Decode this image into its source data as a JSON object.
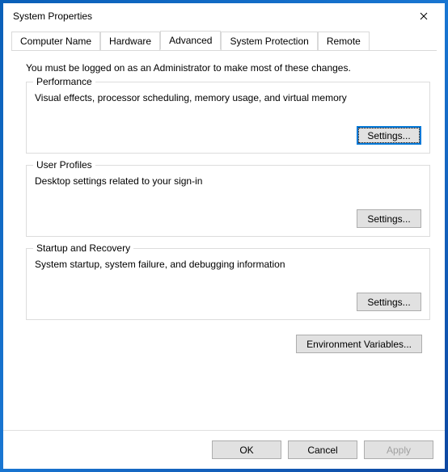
{
  "titlebar": {
    "title": "System Properties"
  },
  "tabs": {
    "computer_name": "Computer Name",
    "hardware": "Hardware",
    "advanced": "Advanced",
    "system_protection": "System Protection",
    "remote": "Remote"
  },
  "panel": {
    "intro": "You must be logged on as an Administrator to make most of these changes."
  },
  "performance": {
    "legend": "Performance",
    "desc": "Visual effects, processor scheduling, memory usage, and virtual memory",
    "button": "Settings..."
  },
  "user_profiles": {
    "legend": "User Profiles",
    "desc": "Desktop settings related to your sign-in",
    "button": "Settings..."
  },
  "startup_recovery": {
    "legend": "Startup and Recovery",
    "desc": "System startup, system failure, and debugging information",
    "button": "Settings..."
  },
  "env_button": "Environment Variables...",
  "buttons": {
    "ok": "OK",
    "cancel": "Cancel",
    "apply": "Apply"
  }
}
